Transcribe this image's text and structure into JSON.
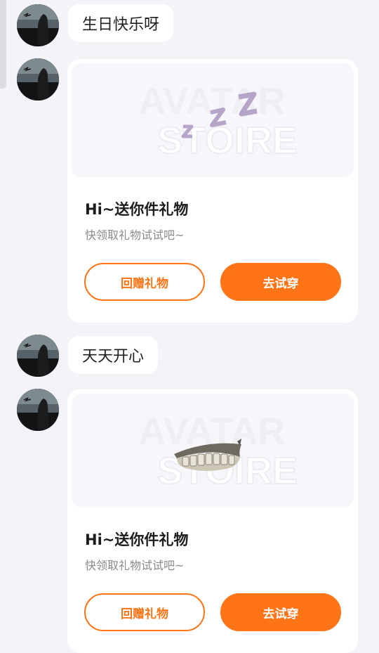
{
  "messages": [
    {
      "type": "text",
      "text": "生日快乐呀"
    },
    {
      "type": "gift_card",
      "gift_icon": "zzz-sleep-icon",
      "title": "Hi~送你件礼物",
      "subtitle": "快领取礼物试试吧~",
      "secondary_button": "回赠礼物",
      "primary_button": "去试穿"
    },
    {
      "type": "text",
      "text": "天天开心"
    },
    {
      "type": "gift_card",
      "gift_icon": "grillz-teeth-icon",
      "title": "Hi~送你件礼物",
      "subtitle": "快领取礼物试试吧~",
      "secondary_button": "回赠礼物",
      "primary_button": "去试穿"
    }
  ],
  "watermark": {
    "line1": "AVATAR",
    "line2": "STOIRE"
  },
  "colors": {
    "accent": "#ff7417",
    "background": "#f4f4f8",
    "bubble": "#ffffff",
    "preview_bg": "#f7f7fb",
    "zzz": "#b6a5c9"
  }
}
